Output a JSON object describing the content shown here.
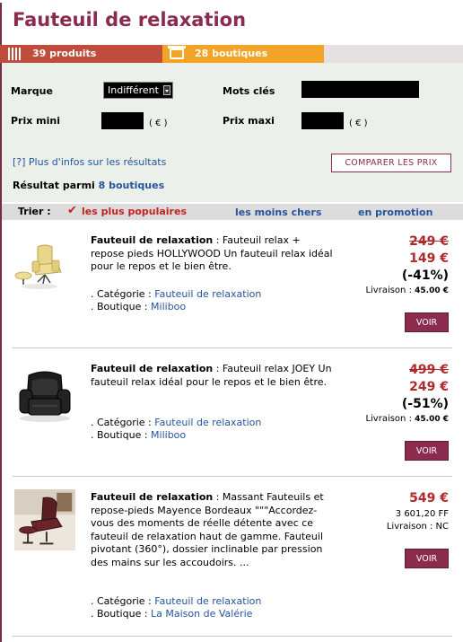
{
  "page": {
    "title": "Fauteuil de relaxation"
  },
  "counts": {
    "products": "39 produits",
    "shops": "28 boutiques"
  },
  "filters": {
    "brand_label": "Marque",
    "brand_value": "Indifférent",
    "keywords_label": "Mots clés",
    "min_price_label": "Prix mini",
    "max_price_label": "Prix maxi",
    "currency_unit": "( € )",
    "info_link": "[?] Plus d'infos sur les résultats",
    "compare_button": "COMPARER LES PRIX",
    "result_prefix": "Résultat parmi ",
    "result_shops": "8 boutiques"
  },
  "sort": {
    "label": "Trier :",
    "check": "✔",
    "popular": "les plus populaires",
    "cheapest": "les moins chers",
    "promo": "en promotion"
  },
  "products": [
    {
      "name": "Fauteuil de relaxation",
      "text": " : Fauteuil relax + repose pieds HOLLYWOOD Un fauteuil relax idéal pour le repos et le bien être.",
      "category_label": ". Catégorie : ",
      "category": "Fauteuil de relaxation",
      "shop_label": ". Boutique : ",
      "shop": "Miliboo",
      "old_price": "249 €",
      "price": "149 €",
      "discount": "(-41%)",
      "shipping_label": "Livraison : ",
      "shipping": "45.00 €",
      "button": "VOIR"
    },
    {
      "name": "Fauteuil de relaxation",
      "text": " : Fauteuil relax JOEY Un fauteuil relax idéal pour le repos et le bien être.",
      "category_label": ". Catégorie : ",
      "category": "Fauteuil de relaxation",
      "shop_label": ". Boutique : ",
      "shop": "Miliboo",
      "old_price": "499 €",
      "price": "249 €",
      "discount": "(-51%)",
      "shipping_label": "Livraison : ",
      "shipping": "45.00 €",
      "button": "VOIR"
    },
    {
      "name": "Fauteuil de relaxation",
      "text": " : Massant Fauteuils et repose-pieds Mayence Bordeaux \"\"\"Accordez-vous des moments de réelle détente avec ce fauteuil de relaxation haut de gamme. Fauteuil pivotant (360°), dossier inclinable par pression des mains sur les accoudoirs. ...",
      "category_label": ". Catégorie : ",
      "category": "Fauteuil de relaxation",
      "shop_label": ". Boutique : ",
      "shop": "La Maison de Valérie",
      "price": "549 €",
      "price_ff": "3 601,20 FF",
      "shipping_label": "Livraison : ",
      "shipping": "NC",
      "button": "VOIR"
    }
  ],
  "colors": {
    "brand": "#8b2c4e",
    "link": "#24559b",
    "price": "#b12a2a",
    "products_tab": "#c04d3b",
    "shops_tab": "#f3a427"
  }
}
